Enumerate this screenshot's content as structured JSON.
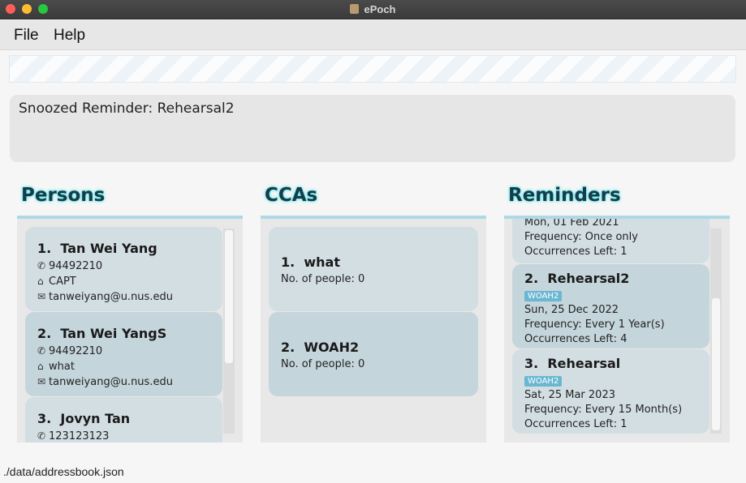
{
  "window": {
    "title": "ePoch"
  },
  "menu": {
    "file": "File",
    "help": "Help"
  },
  "command_box": {
    "value": ""
  },
  "result": {
    "text": "Snoozed Reminder: Rehearsal2"
  },
  "panels": {
    "persons_title": "Persons",
    "ccas_title": "CCAs",
    "reminders_title": "Reminders"
  },
  "persons": [
    {
      "index": "1.",
      "name": "Tan Wei Yang",
      "phone": "94492210",
      "cca": "CAPT",
      "email": "tanweiyang@u.nus.edu"
    },
    {
      "index": "2.",
      "name": "Tan Wei YangS",
      "phone": "94492210",
      "cca": "what",
      "email": "tanweiyang@u.nus.edu"
    },
    {
      "index": "3.",
      "name": "Jovyn Tan",
      "phone": "123123123"
    }
  ],
  "ccas": [
    {
      "index": "1.",
      "name": "what",
      "people": "No. of people: 0"
    },
    {
      "index": "2.",
      "name": "WOAH2",
      "people": "No. of people: 0"
    }
  ],
  "reminders": [
    {
      "date": "Mon, 01 Feb 2021",
      "frequency": "Frequency: Once only",
      "occurrences": "Occurrences Left: 1"
    },
    {
      "index": "2.",
      "name": "Rehearsal2",
      "tag": "WOAH2",
      "date": "Sun, 25 Dec 2022",
      "frequency": "Frequency: Every 1 Year(s)",
      "occurrences": "Occurrences Left: 4"
    },
    {
      "index": "3.",
      "name": "Rehearsal",
      "tag": "WOAH2",
      "date": "Sat, 25 Mar 2023",
      "frequency": "Frequency: Every 15 Month(s)",
      "occurrences": "Occurrences Left: 1"
    }
  ],
  "icons": {
    "phone": "phone-icon",
    "cca": "house-icon",
    "email": "mail-icon"
  },
  "colors": {
    "accent": "#add8e6",
    "tag": "#6ab7d2",
    "card_light": "#d3dee3",
    "card_dark": "#c5d5dc"
  },
  "status": {
    "path": "./data/addressbook.json"
  }
}
